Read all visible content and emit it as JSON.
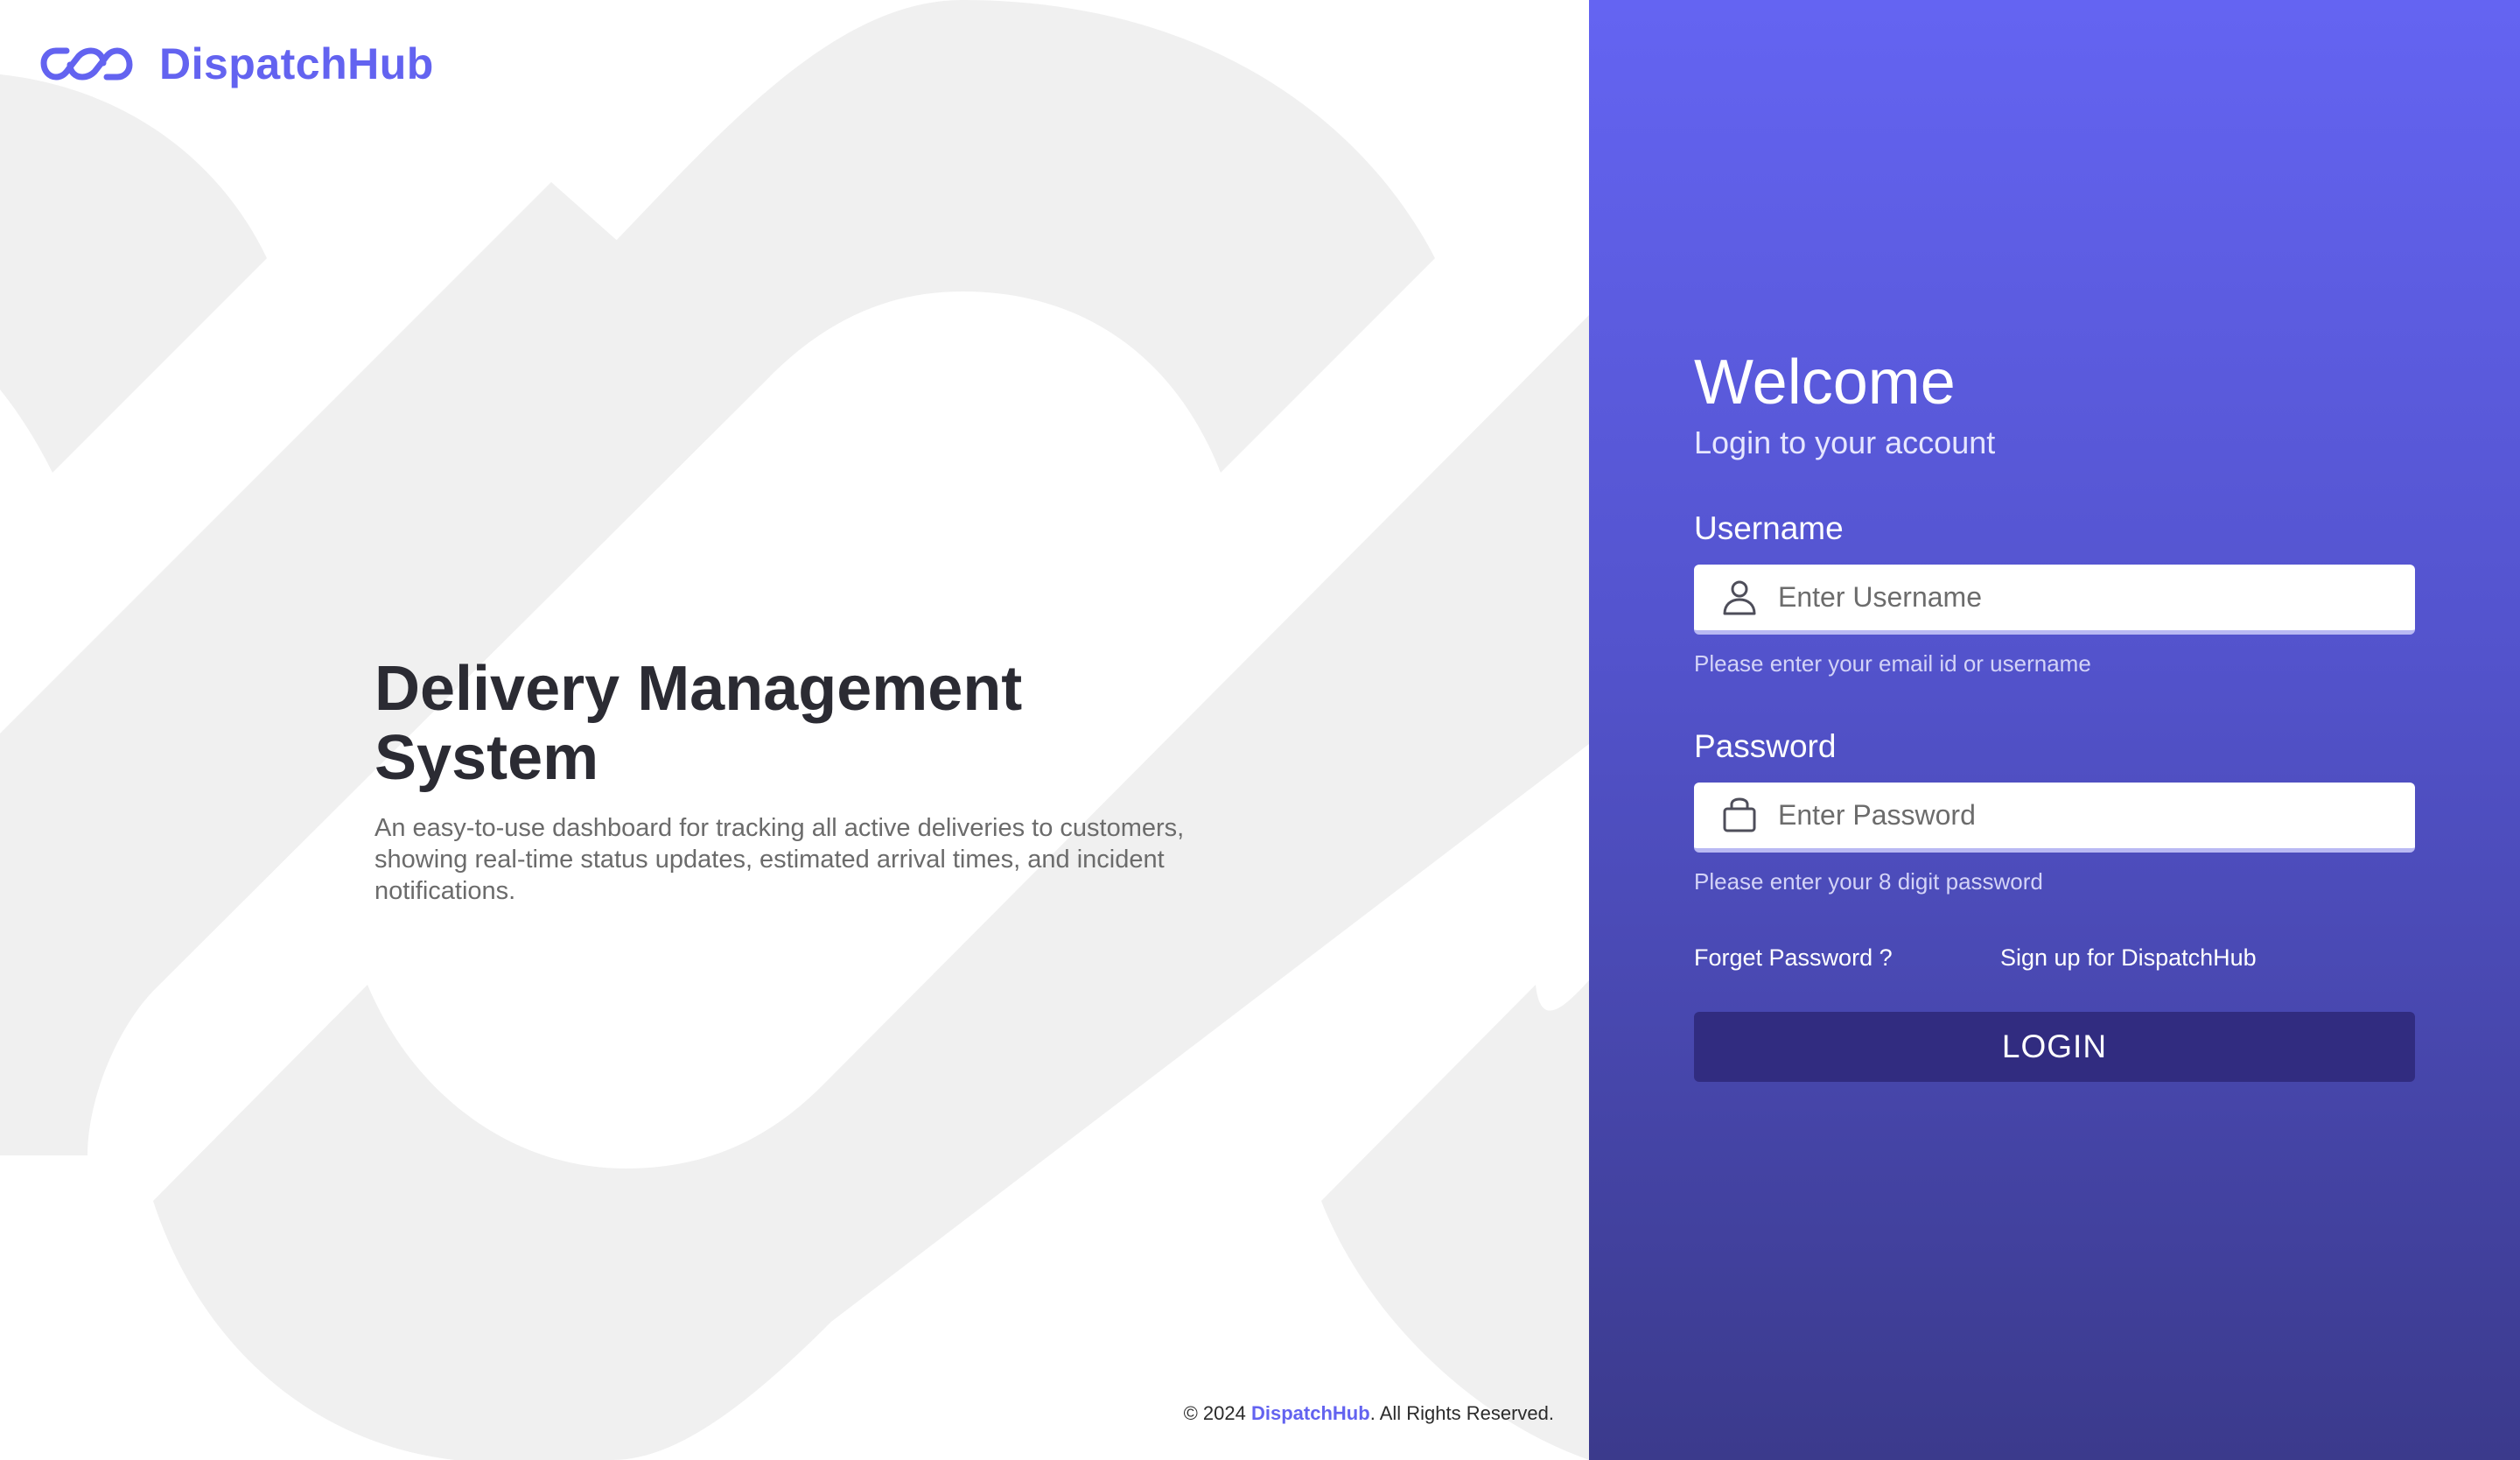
{
  "brand": {
    "name": "DispatchHub",
    "logo_icon": "infinity-chain-icon",
    "color": "#6363f0"
  },
  "hero": {
    "title": "Delivery Management System",
    "description": "An easy-to-use dashboard for tracking all active deliveries to customers, showing real-time status updates, estimated arrival times, and incident notifications."
  },
  "footer": {
    "copyright_prefix": "© 2024 ",
    "brand_link": "DispatchHub",
    "copyright_suffix": ". All Rights Reserved."
  },
  "login": {
    "welcome": "Welcome",
    "subtitle": "Login to your account",
    "username": {
      "label": "Username",
      "placeholder": "Enter Username",
      "value": "",
      "hint": "Please enter your email id or username",
      "icon": "user-icon"
    },
    "password": {
      "label": "Password",
      "placeholder": "Enter Password",
      "value": "",
      "hint": "Please enter your 8 digit password",
      "icon": "lock-icon"
    },
    "forgot_password": "Forget Password ?",
    "signup": "Sign up for DispatchHub",
    "button": "LOGIN"
  },
  "colors": {
    "panel_gradient_top": "#6464f2",
    "panel_gradient_bottom": "#3b3a8c",
    "button": "#312c80",
    "background_art": "#f0f0f0"
  }
}
